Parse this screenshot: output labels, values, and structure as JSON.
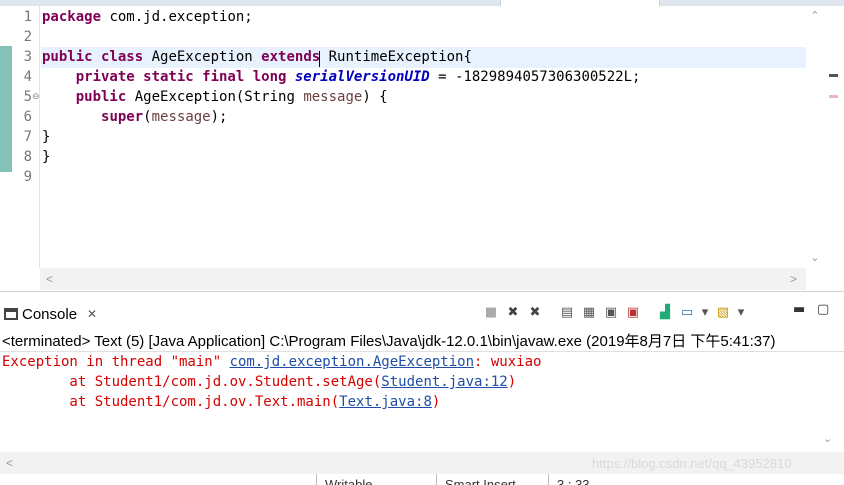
{
  "editor": {
    "line_numbers": [
      "1",
      "2",
      "3",
      "4",
      "5",
      "6",
      "7",
      "8",
      "9"
    ],
    "lines": {
      "l1": {
        "kw": "package",
        "rest": " com.jd.exception;"
      },
      "l3": {
        "kw1": "public class",
        "name": " AgeException ",
        "kw2": "extends",
        "rest": " RuntimeException{"
      },
      "l4": {
        "indent": "    ",
        "kw": "private static final long",
        "field": "serialVersionUID",
        "rest": " = -1829894057306300522L;"
      },
      "l5": {
        "indent": "    ",
        "kw": "public",
        "mid": " AgeException(String ",
        "param": "message",
        "rest": ") {"
      },
      "l6": {
        "indent": "       ",
        "kw": "super",
        "open": "(",
        "param": "message",
        "rest": ");"
      },
      "l7": {
        "text": "}"
      },
      "l8": {
        "text": "}"
      }
    },
    "fold_marker": "⊖"
  },
  "console": {
    "tab_label": "Console",
    "close_glyph": "✕",
    "header": "<terminated> Text (5) [Java Application] C:\\Program Files\\Java\\jdk-12.0.1\\bin\\javaw.exe (2019年8月7日 下午5:41:37)",
    "out1": {
      "prefix": "Exception in thread \"main\" ",
      "link": "com.jd.exception.AgeException",
      "suffix": ": wuxiao"
    },
    "out2": {
      "prefix": "        at Student1/com.jd.ov.Student.setAge(",
      "link": "Student.java:12",
      "suffix": ")"
    },
    "out3": {
      "prefix": "        at Student1/com.jd.ov.Text.main(",
      "link": "Text.java:8",
      "suffix": ")"
    },
    "toolbar_icons": [
      "terminate-icon",
      "remove-launch-icon",
      "remove-all-icon",
      "scroll-lock-icon",
      "word-wrap-icon",
      "show-on-stdout-icon",
      "show-on-stderr-icon",
      "pin-console-icon",
      "display-console-icon",
      "open-console-icon"
    ],
    "watermark": "https://blog.csdn.net/qq_43952810"
  },
  "status_bar": {
    "writable": "Writable",
    "insert_mode": "Smart Insert",
    "position": "3 : 33"
  },
  "colors": {
    "keyword": "#7f0055",
    "field": "#0000c0",
    "error_text": "#d60000",
    "link": "#1e4ea8",
    "change_bar": "#84c1b6"
  }
}
